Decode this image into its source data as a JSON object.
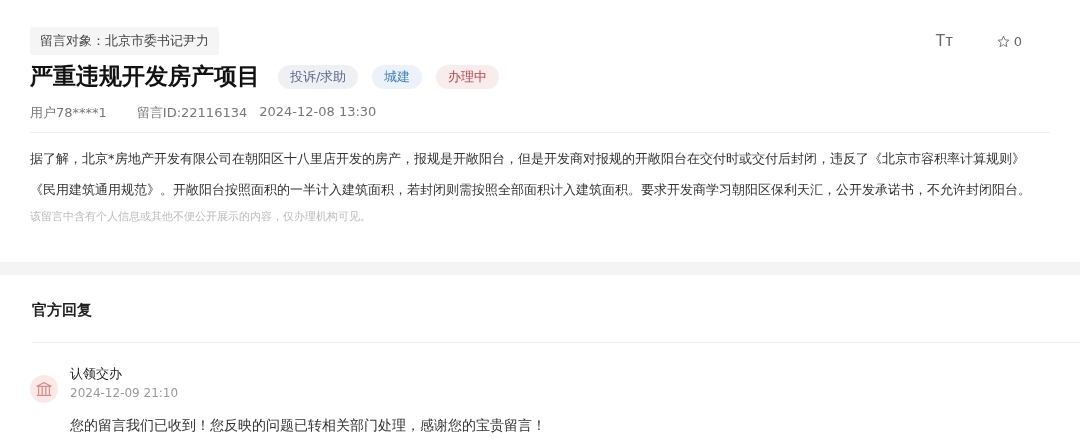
{
  "recipient": "留言对象：北京市委书记尹力",
  "title": "严重违规开发房产项目",
  "tags": [
    {
      "label": "投诉/求助",
      "color": "#5b6b8c"
    },
    {
      "label": "城建",
      "color": "#3f7fc0"
    },
    {
      "label": "办理中",
      "color": "#c0454a"
    }
  ],
  "toolbar": {
    "font_size_glyph": "Tт",
    "favorites": "0"
  },
  "meta": {
    "user": "用户78****1",
    "message_id": "留言ID:22116134",
    "time": "2024-12-08 13:30"
  },
  "body": "据了解，北京*房地产开发有限公司在朝阳区十八里店开发的房产，报规是开敞阳台，但是开发商对报规的开敞阳台在交付时或交付后封闭，违反了《北京市容积率计算规则》《民用建筑通用规范》。开敞阳台按照面积的一半计入建筑面积，若封闭则需按照全部面积计入建筑面积。要求开发商学习朝阳区保利天汇，公开发承诺书，不允许封闭阳台。",
  "privacy_note": "该留言中含有个人信息或其他不便公开展示的内容，仅办理机构可见。",
  "reply": {
    "heading": "官方回复",
    "author": "认领交办",
    "time": "2024-12-09 21:10",
    "text": "您的留言我们已收到！您反映的问题已转相关部门处理，感谢您的宝贵留言！"
  }
}
